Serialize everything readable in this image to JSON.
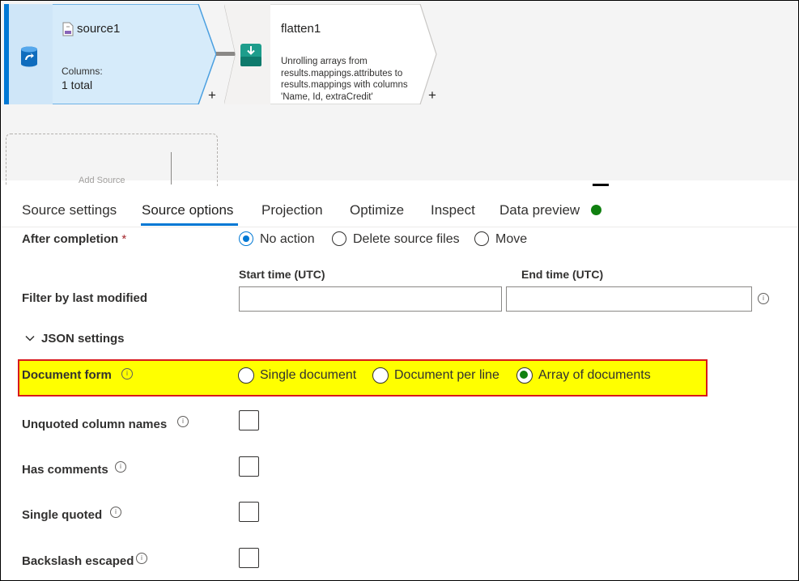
{
  "canvas": {
    "source_node": {
      "title": "source1",
      "columns_label": "Columns:",
      "columns_value": "1 total",
      "icon": "database-refresh-icon"
    },
    "flatten_node": {
      "title": "flatten1",
      "description": "Unrolling arrays from results.mappings.attributes to results.mappings with columns 'Name, Id, extraCredit'",
      "icon": "flatten-icon"
    },
    "add_symbol": "+",
    "ghost_text": "Add Source"
  },
  "tabs": [
    {
      "label": "Source settings"
    },
    {
      "label": "Source options",
      "active": true
    },
    {
      "label": "Projection"
    },
    {
      "label": "Optimize"
    },
    {
      "label": "Inspect"
    },
    {
      "label": "Data preview",
      "status_color": "#108010"
    }
  ],
  "form": {
    "after_completion": {
      "label": "After completion",
      "required_mark": "*",
      "options": [
        {
          "label": "No action",
          "selected": true
        },
        {
          "label": "Delete source files",
          "selected": false
        },
        {
          "label": "Move",
          "selected": false
        }
      ]
    },
    "filter": {
      "label": "Filter by last modified",
      "start_label": "Start time (UTC)",
      "end_label": "End time (UTC)",
      "start_value": "",
      "end_value": ""
    },
    "json_settings": {
      "label": "JSON settings",
      "expanded": true
    },
    "document_form": {
      "label": "Document form",
      "options": [
        {
          "label": "Single document",
          "selected": false
        },
        {
          "label": "Document per line",
          "selected": false
        },
        {
          "label": "Array of documents",
          "selected": true
        }
      ]
    },
    "checkboxes": [
      {
        "label": "Unquoted column names",
        "checked": false
      },
      {
        "label": "Has comments",
        "checked": false
      },
      {
        "label": "Single quoted",
        "checked": false
      },
      {
        "label": "Backslash escaped",
        "checked": false
      }
    ],
    "info_glyph": "i"
  },
  "colors": {
    "accent": "#0078d4",
    "highlight": "#ffff00",
    "highlight_border": "#d8191c",
    "success": "#108010"
  }
}
